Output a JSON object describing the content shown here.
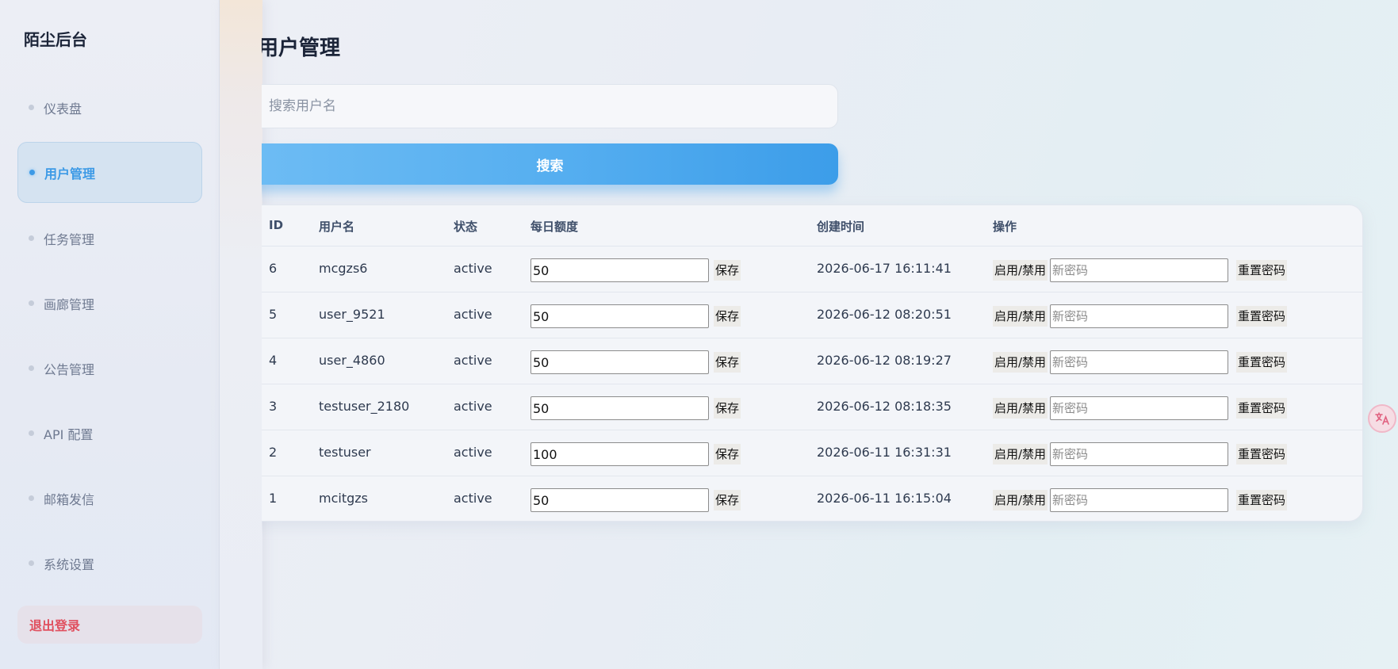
{
  "sidebar": {
    "brand": "陌尘后台",
    "items": [
      {
        "label": "仪表盘"
      },
      {
        "label": "用户管理"
      },
      {
        "label": "任务管理"
      },
      {
        "label": "画廊管理"
      },
      {
        "label": "公告管理"
      },
      {
        "label": "API 配置"
      },
      {
        "label": "邮箱发信"
      },
      {
        "label": "系统设置"
      }
    ],
    "logout": "退出登录"
  },
  "main": {
    "title": "用户管理",
    "search": {
      "placeholder": "搜索用户名",
      "button": "搜索"
    }
  },
  "table": {
    "headers": {
      "id": "ID",
      "username": "用户名",
      "status": "状态",
      "quota": "每日额度",
      "created": "创建时间",
      "actions": "操作"
    },
    "actions": {
      "save": "保存",
      "toggle": "启用/禁用",
      "password_placeholder": "新密码",
      "reset": "重置密码"
    },
    "rows": [
      {
        "id": "6",
        "username": "mcgzs6",
        "status": "active",
        "quota": "50",
        "created": "2026-06-17 16:11:41"
      },
      {
        "id": "5",
        "username": "user_9521",
        "status": "active",
        "quota": "50",
        "created": "2026-06-12 08:20:51"
      },
      {
        "id": "4",
        "username": "user_4860",
        "status": "active",
        "quota": "50",
        "created": "2026-06-12 08:19:27"
      },
      {
        "id": "3",
        "username": "testuser_2180",
        "status": "active",
        "quota": "50",
        "created": "2026-06-12 08:18:35"
      },
      {
        "id": "2",
        "username": "testuser",
        "status": "active",
        "quota": "100",
        "created": "2026-06-11 16:31:31"
      },
      {
        "id": "1",
        "username": "mcitgzs",
        "status": "active",
        "quota": "50",
        "created": "2026-06-11 16:15:04"
      }
    ]
  },
  "colors": {
    "accent": "#3d9ae6",
    "danger": "#e0505f"
  },
  "icons": {
    "nav_bullet": "dot-icon",
    "translate": "translate-icon"
  }
}
